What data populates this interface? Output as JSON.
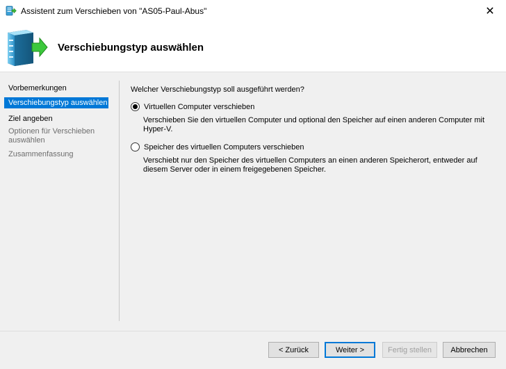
{
  "window": {
    "title": "Assistent zum Verschieben von \"AS05-Paul-Abus\"",
    "app_icon": "move-vm-icon"
  },
  "header": {
    "heading": "Verschiebungstyp auswählen",
    "icon": "server-move-icon"
  },
  "nav": {
    "items": [
      {
        "label": "Vorbemerkungen",
        "state": "normal"
      },
      {
        "label": "Verschiebungstyp auswählen",
        "state": "active"
      },
      {
        "label": "Ziel angeben",
        "state": "normal"
      },
      {
        "label": "Optionen für Verschieben auswählen",
        "state": "disabled"
      },
      {
        "label": "Zusammenfassung",
        "state": "disabled"
      }
    ]
  },
  "main": {
    "question": "Welcher Verschiebungstyp soll ausgeführt werden?",
    "options": [
      {
        "label": "Virtuellen Computer verschieben",
        "checked": true,
        "description": "Verschieben Sie den virtuellen Computer und optional den Speicher auf einen anderen Computer mit Hyper-V."
      },
      {
        "label": "Speicher des virtuellen Computers verschieben",
        "checked": false,
        "description": "Verschiebt nur den Speicher des virtuellen Computers an einen anderen Speicherort, entweder auf diesem Server oder in einem freigegebenen Speicher."
      }
    ]
  },
  "buttons": {
    "back": "< Zurück",
    "next": "Weiter >",
    "finish": "Fertig stellen",
    "cancel": "Abbrechen"
  },
  "colors": {
    "accent": "#0078d7",
    "disabled_text": "#6d6d6d"
  }
}
